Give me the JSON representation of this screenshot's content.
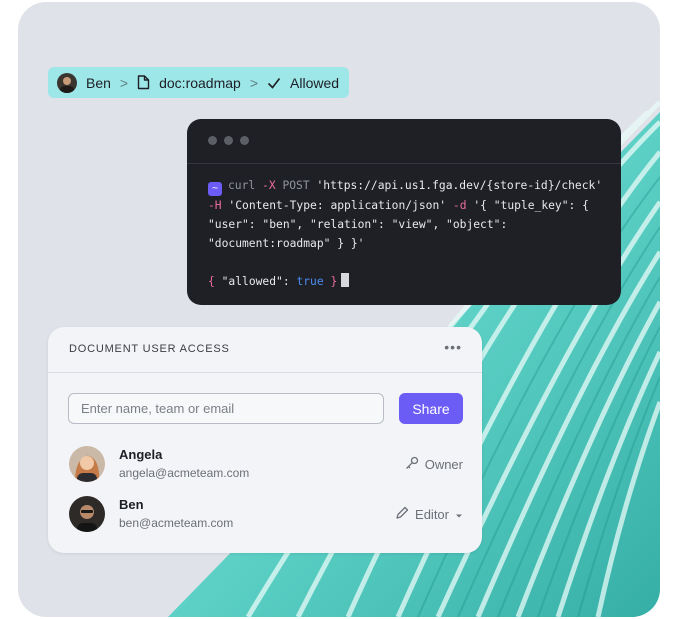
{
  "breadcrumb": {
    "user": "Ben",
    "resource": "doc:roadmap",
    "result": "Allowed"
  },
  "terminal": {
    "prompt_symbol": "~",
    "cmd": "curl",
    "flag_x": "-X",
    "method": "POST",
    "url": "'https://api.us1.fga.dev/{store-id}/check'",
    "flag_h": "-H",
    "header": "'Content-Type: application/json'",
    "flag_d": "-d",
    "body_line1": "'{ \"tuple_key\": {",
    "body_line2": "\"user\": \"ben\", \"relation\": \"view\", \"object\":",
    "body_line3": "\"document:roadmap\" } }'",
    "resp_open": "{ ",
    "resp_key": "\"allowed\"",
    "resp_colon": ": ",
    "resp_value": "true",
    "resp_close": " }"
  },
  "access_card": {
    "title": "DOCUMENT USER ACCESS",
    "more": "•••",
    "input_placeholder": "Enter name, team or email",
    "share_label": "Share",
    "users": [
      {
        "name": "Angela",
        "email": "angela@acmeteam.com",
        "role": "Owner",
        "role_icon": "key-icon"
      },
      {
        "name": "Ben",
        "email": "ben@acmeteam.com",
        "role": "Editor",
        "role_icon": "pencil-icon"
      }
    ]
  },
  "colors": {
    "accent": "#6b5cf6",
    "breadcrumb_bg": "#9ee7e8",
    "terminal_bg": "#1e2026",
    "teal": "#3fc4b8"
  }
}
